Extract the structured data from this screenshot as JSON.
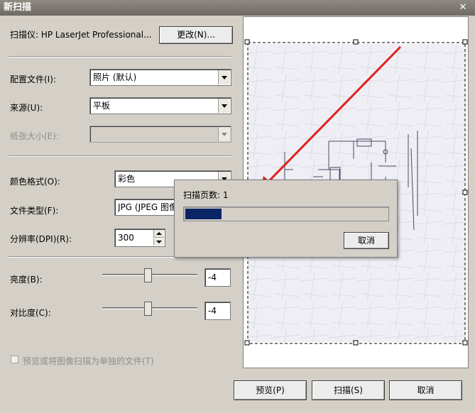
{
  "window": {
    "title": "新扫描",
    "close_glyph": "✕"
  },
  "scanner": {
    "label": "扫描仪: HP LaserJet Professional...",
    "change_button": "更改(N)..."
  },
  "profile": {
    "label": "配置文件(I):",
    "value": "照片 (默认)"
  },
  "source": {
    "label": "来源(U):",
    "value": "平板"
  },
  "paper_size": {
    "label": "纸张大小(E):",
    "value": ""
  },
  "color_format": {
    "label": "颜色格式(O):",
    "value": "彩色"
  },
  "file_type": {
    "label": "文件类型(F):",
    "value": "JPG (JPEG 图像)"
  },
  "resolution": {
    "label": "分辨率(DPI)(R):",
    "value": "300"
  },
  "brightness": {
    "label": "亮度(B):",
    "value": "-4",
    "slider_fraction": 0.48
  },
  "contrast": {
    "label": "对比度(C):",
    "value": "-4",
    "slider_fraction": 0.48
  },
  "separate_files": {
    "label": "预览或将图像扫描为单独的文件(T)",
    "checked": false
  },
  "progress_dialog": {
    "text": "扫描页数: 1",
    "cancel_button": "取消",
    "progress_fraction": 0.18
  },
  "buttons": {
    "preview": "预览(P)",
    "scan": "扫描(S)",
    "cancel": "取消"
  },
  "colors": {
    "progress_fill": "#0a2466",
    "arrow": "#e0201e",
    "titlebar": "#7c7870"
  }
}
